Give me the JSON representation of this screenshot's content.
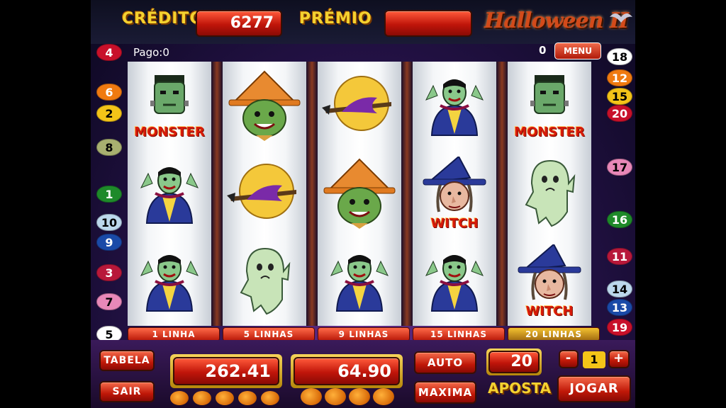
{
  "header": {
    "credit_label": "CRÉDITO",
    "credit_value": "6277",
    "prize_label": "PRÉMIO",
    "prize_value": "",
    "logo": "Halloween II"
  },
  "status": {
    "paid_text": "Pago:0",
    "small_counter": "0",
    "menu_label": "MENU"
  },
  "reels": [
    [
      {
        "icon": "frankenstein-icon",
        "label": "MONSTER"
      },
      {
        "icon": "dracula-icon",
        "label": ""
      },
      {
        "icon": "dracula-icon",
        "label": ""
      }
    ],
    [
      {
        "icon": "scarecrow-icon",
        "label": ""
      },
      {
        "icon": "witch-moon-icon",
        "label": ""
      },
      {
        "icon": "ghost-icon",
        "label": ""
      }
    ],
    [
      {
        "icon": "witch-moon-icon",
        "label": ""
      },
      {
        "icon": "scarecrow-icon",
        "label": ""
      },
      {
        "icon": "dracula-icon",
        "label": ""
      }
    ],
    [
      {
        "icon": "dracula-icon",
        "label": ""
      },
      {
        "icon": "witch-icon",
        "label": "WITCH"
      },
      {
        "icon": "dracula-icon",
        "label": ""
      }
    ],
    [
      {
        "icon": "frankenstein-icon",
        "label": "MONSTER"
      },
      {
        "icon": "ghost-icon",
        "label": ""
      },
      {
        "icon": "witch-icon",
        "label": "WITCH"
      }
    ]
  ],
  "left_lines": [
    "4",
    "6",
    "2",
    "8",
    "1",
    "10",
    "9",
    "3",
    "7",
    "5"
  ],
  "right_lines": [
    "18",
    "12",
    "15",
    "20",
    "17",
    "16",
    "11",
    "14",
    "13",
    "19"
  ],
  "line_buttons": [
    {
      "label": "1 LINHA",
      "selected": false
    },
    {
      "label": "5 LINHAS",
      "selected": false
    },
    {
      "label": "9 LINHAS",
      "selected": false
    },
    {
      "label": "15 LINHAS",
      "selected": false
    },
    {
      "label": "20 LINHAS",
      "selected": true
    }
  ],
  "controls": {
    "table_label": "TABELA",
    "exit_label": "SAIR",
    "display_left": "262.41",
    "display_right": "64.90",
    "auto_label": "AUTO",
    "max_label": "MAXIMA",
    "bet_value": "20",
    "bet_label": "APOSTA",
    "minus_label": "-",
    "level_value": "1",
    "plus_label": "+",
    "play_label": "JOGAR"
  },
  "colors": {
    "badge_red": "#c8102a",
    "badge_orange": "#f07a10",
    "badge_yellow": "#f4c418",
    "badge_olive": "#a8b070",
    "badge_green": "#1e8a2a",
    "badge_lightblue": "#bcd8ec",
    "badge_blue": "#1a4aa8",
    "badge_crimson": "#b8183a",
    "badge_pink": "#e888b8",
    "badge_white": "#ffffff"
  }
}
